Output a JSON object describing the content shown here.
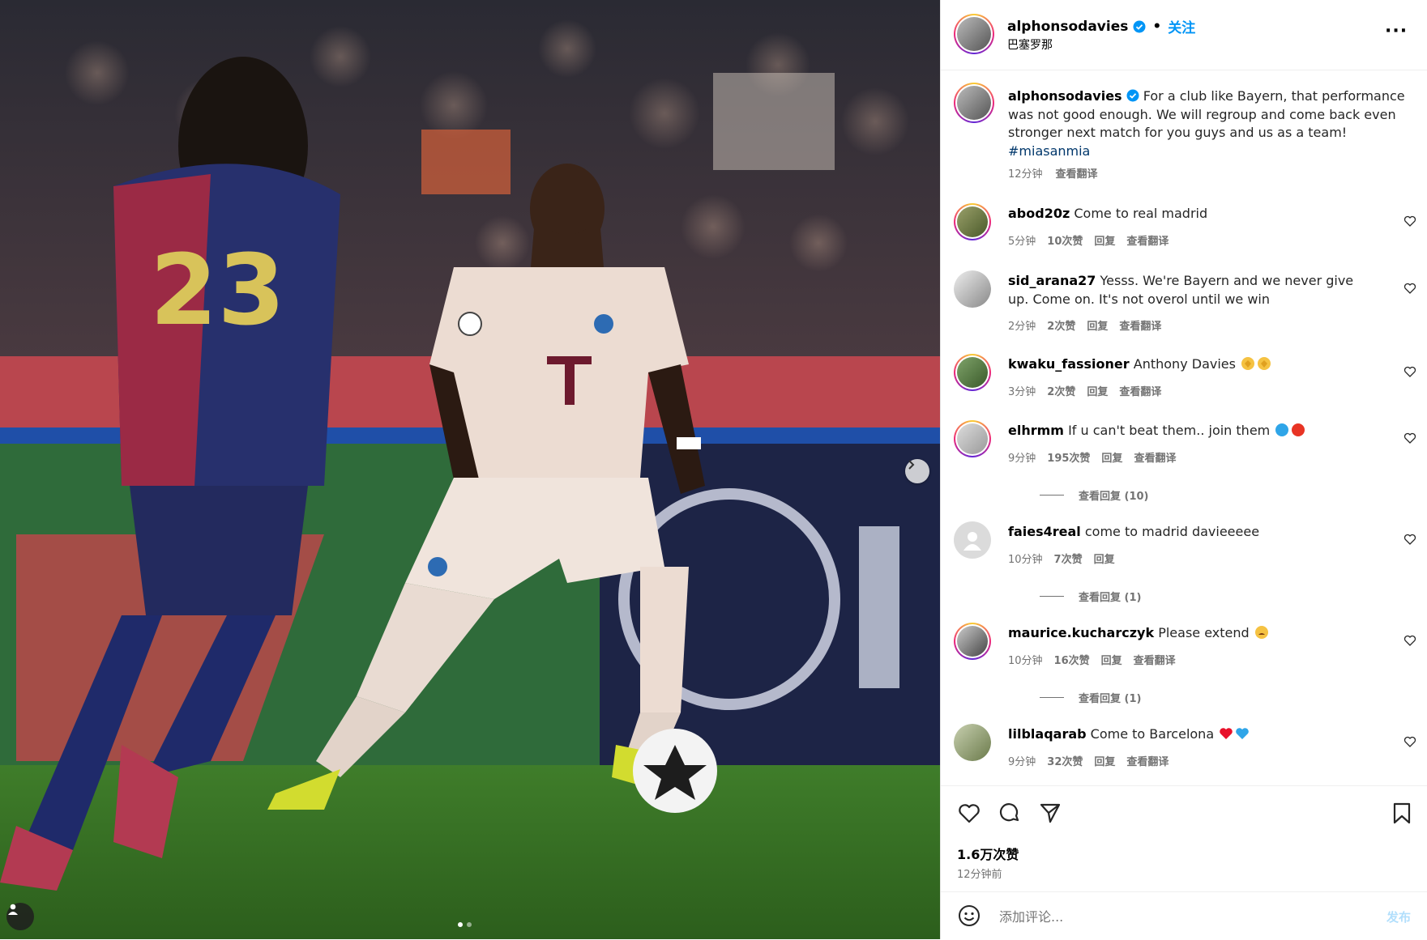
{
  "post": {
    "username": "alphonsodavies",
    "follow_label": "关注",
    "dot": "•",
    "location": "巴塞罗那",
    "more": "···",
    "caption": {
      "username": "alphonsodavies",
      "text": "For a club like Bayern, that performance was not good enough. We will regroup and come back even stronger next match for you guys and us as a team!",
      "hashtag": "#miasanmia",
      "time": "12分钟",
      "translate": "查看翻译"
    },
    "likes": "1.6万次赞",
    "time_ago": "12分钟前"
  },
  "comments": [
    {
      "username": "abod20z",
      "text": "Come to real madrid",
      "time": "5分钟",
      "likes": "10次赞",
      "reply": "回复",
      "translate": "查看翻译"
    },
    {
      "username": "sid_arana27",
      "text": "Yesss. We're Bayern and we never give up. Come on. It's not overol until we win",
      "time": "2分钟",
      "likes": "2次赞",
      "reply": "回复",
      "translate": "查看翻译"
    },
    {
      "username": "kwaku_fassioner",
      "text": "Anthony Davies",
      "time": "3分钟",
      "likes": "2次赞",
      "reply": "回复",
      "translate": "查看翻译"
    },
    {
      "username": "elhrmm",
      "text": "If u can't beat them.. join them",
      "time": "9分钟",
      "likes": "195次赞",
      "reply": "回复",
      "translate": "查看翻译",
      "view_replies": "查看回复 (10)"
    },
    {
      "username": "faies4real",
      "text": "come to madrid davieeeee",
      "time": "10分钟",
      "likes": "7次赞",
      "reply": "回复",
      "view_replies": "查看回复 (1)"
    },
    {
      "username": "maurice.kucharczyk",
      "text": "Please extend",
      "time": "10分钟",
      "likes": "16次赞",
      "reply": "回复",
      "translate": "查看翻译",
      "view_replies": "查看回复 (1)"
    },
    {
      "username": "lilblaqarab",
      "text": "Come to Barcelona",
      "time": "9分钟",
      "likes": "32次赞",
      "reply": "回复",
      "translate": "查看翻译"
    }
  ],
  "comment_box": {
    "placeholder": "添加评论...",
    "post_label": "发布"
  },
  "colors": {
    "accent": "#0095f6",
    "muted": "#737373",
    "post_disabled": "#b2dffc"
  },
  "icons": [
    "verified-badge-icon",
    "more-options-icon",
    "heart-icon",
    "comment-icon",
    "share-icon",
    "bookmark-icon",
    "smile-icon",
    "next-arrow-icon",
    "user-tag-icon"
  ]
}
